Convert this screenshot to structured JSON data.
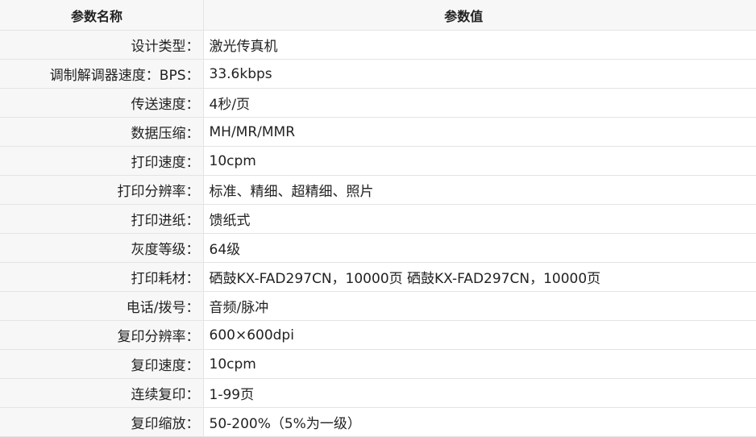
{
  "header": {
    "name_label": "参数名称",
    "value_label": "参数值"
  },
  "rows": [
    {
      "name": "设计类型：",
      "value": "激光传真机"
    },
    {
      "name": "调制解调器速度：BPS：",
      "value": "33.6kbps"
    },
    {
      "name": "传送速度：",
      "value": "4秒/页"
    },
    {
      "name": "数据压缩：",
      "value": "MH/MR/MMR"
    },
    {
      "name": "打印速度：",
      "value": "10cpm"
    },
    {
      "name": "打印分辨率：",
      "value": "标准、精细、超精细、照片"
    },
    {
      "name": "打印进纸：",
      "value": "馈纸式"
    },
    {
      "name": "灰度等级：",
      "value": "64级"
    },
    {
      "name": "打印耗材：",
      "value": "硒鼓KX-FAD297CN，10000页 硒鼓KX-FAD297CN，10000页"
    },
    {
      "name": "电话/拨号：",
      "value": "音频/脉冲"
    },
    {
      "name": "复印分辨率：",
      "value": "600×600dpi"
    },
    {
      "name": "复印速度：",
      "value": "10cpm"
    },
    {
      "name": "连续复印：",
      "value": "1-99页"
    },
    {
      "name": "复印缩放：",
      "value": "50-200%（5%为一级）"
    }
  ]
}
